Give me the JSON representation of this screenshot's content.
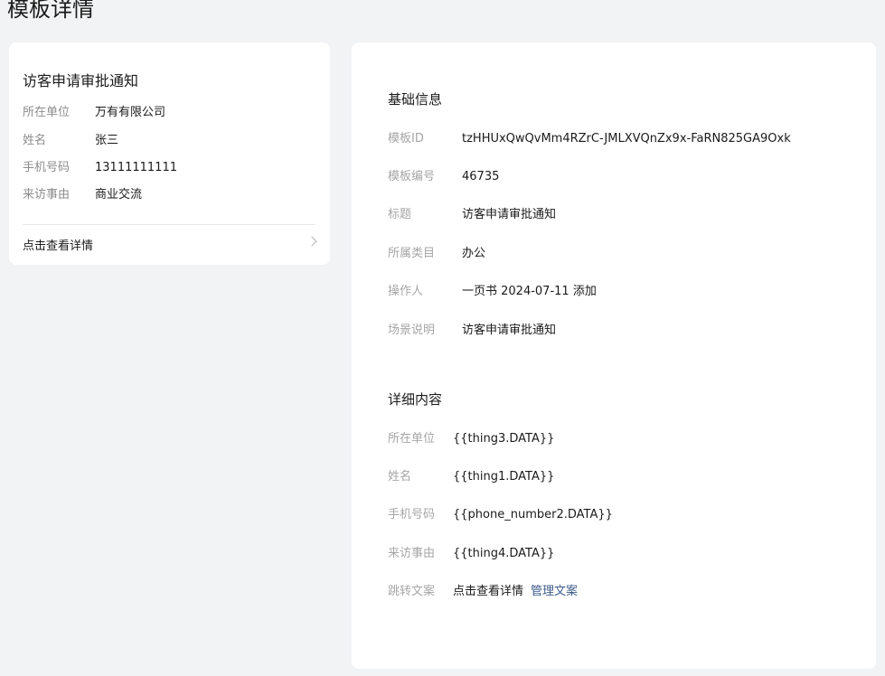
{
  "page": {
    "title": "模板详情"
  },
  "preview": {
    "title": "访客申请审批通知",
    "rows": [
      {
        "label": "所在单位",
        "value": "万有有限公司"
      },
      {
        "label": "姓名",
        "value": "张三"
      },
      {
        "label": "手机号码",
        "value": "13111111111"
      },
      {
        "label": "来访事由",
        "value": "商业交流"
      }
    ],
    "link_text": "点击查看详情"
  },
  "basic_info": {
    "section_title": "基础信息",
    "rows": [
      {
        "label": "模板ID",
        "value": "tzHHUxQwQvMm4RZrC-JMLXVQnZx9x-FaRN825GA9Oxk"
      },
      {
        "label": "模板编号",
        "value": "46735"
      },
      {
        "label": "标题",
        "value": "访客申请审批通知"
      },
      {
        "label": "所属类目",
        "value": "办公"
      },
      {
        "label": "操作人",
        "value": "一页书 2024-07-11 添加"
      },
      {
        "label": "场景说明",
        "value": "访客申请审批通知"
      }
    ]
  },
  "detail_content": {
    "section_title": "详细内容",
    "rows": [
      {
        "label": "所在单位",
        "value": "{{thing3.DATA}}"
      },
      {
        "label": "姓名",
        "value": "{{thing1.DATA}}"
      },
      {
        "label": "手机号码",
        "value": "{{phone_number2.DATA}}"
      },
      {
        "label": "来访事由",
        "value": "{{thing4.DATA}}"
      },
      {
        "label": "跳转文案",
        "value": "点击查看详情",
        "action": "管理文案"
      }
    ]
  }
}
